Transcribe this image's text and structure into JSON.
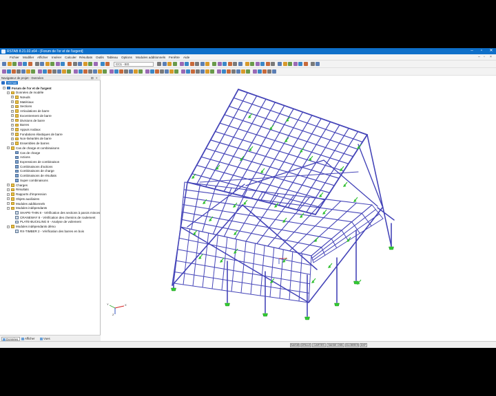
{
  "window": {
    "title": "RSTAB 8.21.02.x64 - [Forum de l'or et de l'argent]",
    "minimize_icon": "minimize-icon",
    "maximize_icon": "maximize-icon",
    "close_icon": "close-icon"
  },
  "menu": {
    "items": [
      "Fichier",
      "Modifier",
      "Afficher",
      "Insérer",
      "Calculer",
      "Résultats",
      "Outils",
      "Tableau",
      "Options",
      "Modules additionnels",
      "Fenêtre",
      "Aide"
    ]
  },
  "toolbar": {
    "load_case_combo": "CC1 - EG"
  },
  "navigator": {
    "header": "Navigateur de projet - Données",
    "badge": "RSTAB",
    "tree": [
      {
        "label": "Forum de l'or et de l'argent",
        "level": 0,
        "kind": "root",
        "bold": true
      },
      {
        "label": "Données de modèle",
        "level": 1,
        "kind": "folder"
      },
      {
        "label": "Nœuds",
        "level": 2,
        "kind": "folder"
      },
      {
        "label": "Matériaux",
        "level": 2,
        "kind": "folder"
      },
      {
        "label": "Sections",
        "level": 2,
        "kind": "folder"
      },
      {
        "label": "Articulations de barre",
        "level": 2,
        "kind": "folder"
      },
      {
        "label": "Excentrement de barre",
        "level": 2,
        "kind": "folder"
      },
      {
        "label": "Divisions de barre",
        "level": 2,
        "kind": "folder"
      },
      {
        "label": "Barres",
        "level": 2,
        "kind": "folder"
      },
      {
        "label": "Appuis nodaux",
        "level": 2,
        "kind": "folder"
      },
      {
        "label": "Fondations élastiques de barre",
        "level": 2,
        "kind": "folder"
      },
      {
        "label": "Non-linéarités de barre",
        "level": 2,
        "kind": "folder"
      },
      {
        "label": "Ensembles de barres",
        "level": 2,
        "kind": "folder"
      },
      {
        "label": "Cas de charge et combinaisons",
        "level": 1,
        "kind": "folder"
      },
      {
        "label": "Cas de charge",
        "level": 2,
        "kind": "item"
      },
      {
        "label": "Actions",
        "level": 2,
        "kind": "item"
      },
      {
        "label": "Expressions de combinaison",
        "level": 2,
        "kind": "item"
      },
      {
        "label": "Combinaisons d'actions",
        "level": 2,
        "kind": "item"
      },
      {
        "label": "Combinaisons de charge",
        "level": 2,
        "kind": "item"
      },
      {
        "label": "Combinaisons de résultats",
        "level": 2,
        "kind": "item"
      },
      {
        "label": "Super combinaisons",
        "level": 2,
        "kind": "item"
      },
      {
        "label": "Charges",
        "level": 1,
        "kind": "folder"
      },
      {
        "label": "Résultats",
        "level": 1,
        "kind": "folder"
      },
      {
        "label": "Rapports d'impression",
        "level": 1,
        "kind": "folder"
      },
      {
        "label": "Objets auxiliaires",
        "level": 1,
        "kind": "folder"
      },
      {
        "label": "Modules additionnels",
        "level": 1,
        "kind": "folder"
      },
      {
        "label": "Modules indépendants",
        "level": 1,
        "kind": "folder"
      },
      {
        "label": "SHAPE-THIN 8 - Vérification des sections à parois minces",
        "level": 2,
        "kind": "module"
      },
      {
        "label": "CRANEWAY 8 - Vérification des chemins de roulement",
        "level": 2,
        "kind": "module"
      },
      {
        "label": "PLATE-BUCKLING 8 - Analyse de voilement",
        "level": 2,
        "kind": "module"
      },
      {
        "label": "Modules indépendants démo",
        "level": 1,
        "kind": "folder"
      },
      {
        "label": "RX-TIMBER 2 - Vérification des barres en bois",
        "level": 2,
        "kind": "module"
      }
    ],
    "tabs": [
      "Données",
      "Afficher",
      "Vues"
    ]
  },
  "statusbar": {
    "buttons": [
      "SAISIE",
      "GRILLE",
      "CARTES",
      "SAISIE OSB",
      "GLOBRES",
      "DXF"
    ]
  },
  "axes": {
    "x": "X",
    "y": "Y",
    "z": "Z"
  },
  "colors": {
    "titlebar": "#0e6fc9",
    "members": "#4444b8",
    "supports": "#33cc33"
  }
}
